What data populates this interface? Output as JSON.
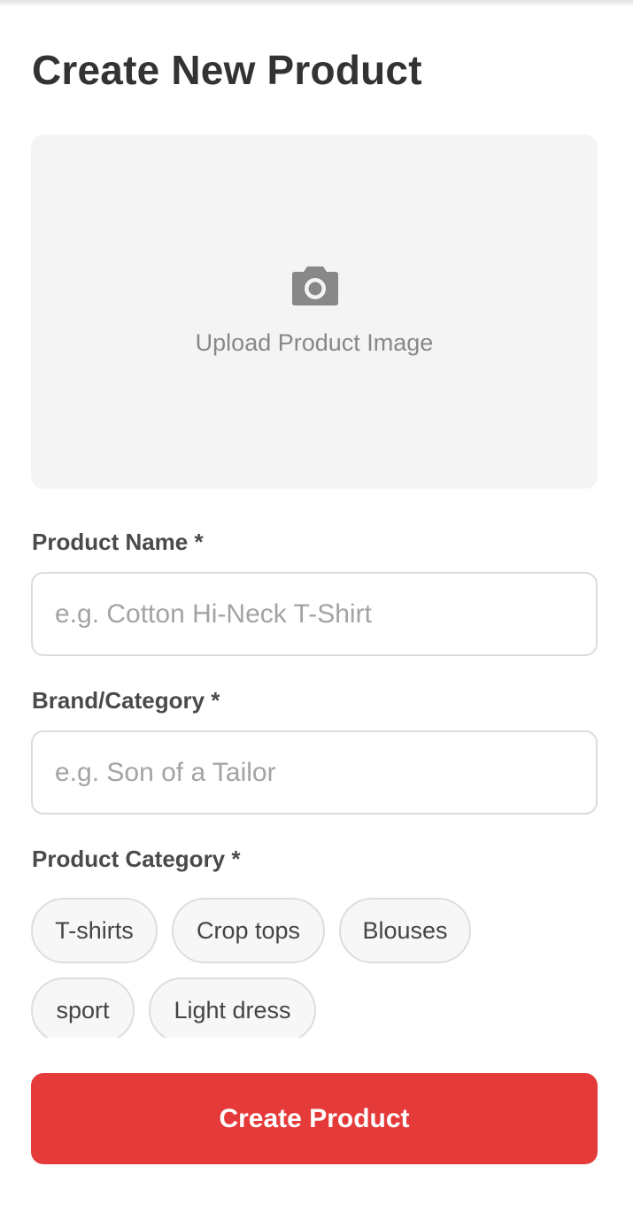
{
  "header": {
    "title": "Create New Product"
  },
  "upload": {
    "icon": "camera-icon",
    "label": "Upload Product Image"
  },
  "form": {
    "product_name": {
      "label": "Product Name *",
      "value": "",
      "placeholder": "e.g. Cotton Hi-Neck T-Shirt"
    },
    "brand": {
      "label": "Brand/Category *",
      "value": "",
      "placeholder": "e.g. Son of a Tailor"
    },
    "category": {
      "label": "Product Category *",
      "options": [
        "T-shirts",
        "Crop tops",
        "Blouses",
        "sport",
        "Light dress"
      ]
    }
  },
  "actions": {
    "submit_label": "Create Product"
  },
  "colors": {
    "accent": "#e53a3a",
    "title_text": "#333333",
    "upload_bg": "#f4f4f4",
    "placeholder": "#a3a3a3",
    "icon": "#888888"
  }
}
